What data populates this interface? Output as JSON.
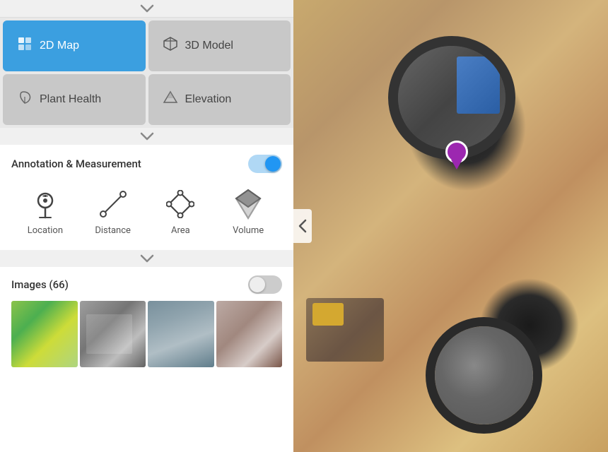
{
  "panel": {
    "collapse_top": "▾",
    "collapse_mid": "▾",
    "collapse_bot": "▾",
    "view_modes": [
      {
        "id": "2d-map",
        "label": "2D Map",
        "icon": "map",
        "active": true
      },
      {
        "id": "3d-model",
        "label": "3D Model",
        "icon": "cube",
        "active": false
      },
      {
        "id": "plant-health",
        "label": "Plant Health",
        "icon": "leaf",
        "active": false
      },
      {
        "id": "elevation",
        "label": "Elevation",
        "icon": "mountain",
        "active": false
      }
    ],
    "annotation": {
      "title": "Annotation & Measurement",
      "toggle_on": true,
      "tools": [
        {
          "id": "location",
          "label": "Location",
          "icon": "location"
        },
        {
          "id": "distance",
          "label": "Distance",
          "icon": "distance"
        },
        {
          "id": "area",
          "label": "Area",
          "icon": "area"
        },
        {
          "id": "volume",
          "label": "Volume",
          "icon": "volume"
        }
      ]
    },
    "images": {
      "title": "Images (66)",
      "toggle_on": false,
      "thumbnails": [
        {
          "id": "thumb-1",
          "type": "green-fields"
        },
        {
          "id": "thumb-2",
          "type": "aerial-industrial"
        },
        {
          "id": "thumb-3",
          "type": "aerial-roads"
        },
        {
          "id": "thumb-4",
          "type": "construction"
        }
      ]
    }
  },
  "map": {
    "pin_color": "#9c27b0",
    "arrow_icon": "‹"
  }
}
